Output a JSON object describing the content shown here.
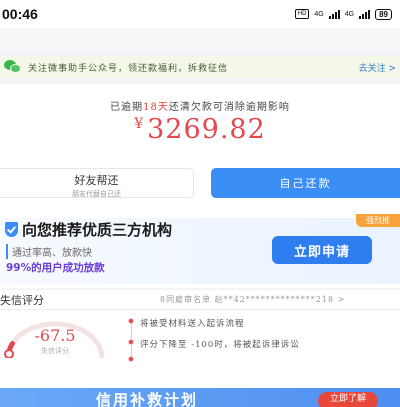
{
  "status_bar": {
    "time": "00:46",
    "indicators": [
      "HD",
      "4G",
      "4G"
    ],
    "battery": "89"
  },
  "notice": {
    "icon": "wechat-icon",
    "text": "关注微事助手公众号，领还款福利，拆救征信",
    "link": "去关注 >"
  },
  "repay": {
    "subtitle_before": "已逾期",
    "subtitle_highlight": "18天",
    "subtitle_after": "还清欠款可消除逾期影响",
    "currency": "¥",
    "amount": "3269.82",
    "friend_button": {
      "label": "好友帮还",
      "sub": "朋友代替自己还"
    },
    "self_button": "自己还款"
  },
  "recommend": {
    "title": "向您推荐优质三方机构",
    "badge": "强烈推",
    "line1": "通过率高、放款快",
    "line2": "99%的用户成功放款",
    "button": "立即申请"
  },
  "credit": {
    "title": "失信评分",
    "id_text": "8同雇审名单 赵**42**************218 >",
    "score": "-67.5",
    "score_label": "失信评分",
    "timeline": [
      "将被受材料送入起诉流程",
      "评分下降至 -100时，将被起诉律诉讼"
    ]
  },
  "banner": {
    "title": "信用补救计划",
    "button": "立即了解"
  },
  "colors": {
    "accent": "#3b8ef5",
    "danger": "#e5484d",
    "badge": "#f7a23a",
    "highlight_text": "#6a3fd6"
  }
}
